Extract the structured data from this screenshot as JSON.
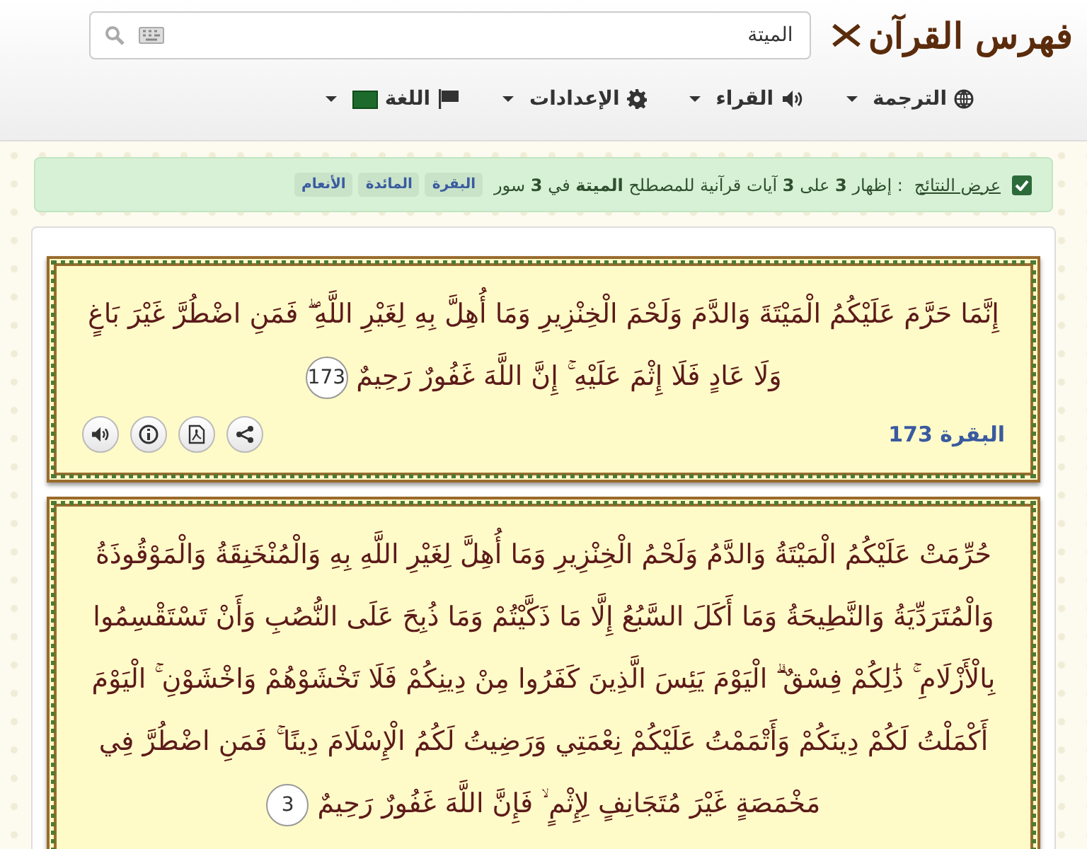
{
  "logo": {
    "title": "فهرس القرآن"
  },
  "search": {
    "value": "الميتة"
  },
  "menu": [
    {
      "label": "الترجمة",
      "kind": "globe"
    },
    {
      "label": "القراء",
      "kind": "speaker"
    },
    {
      "label": "الإعدادات",
      "kind": "gear"
    },
    {
      "label": "اللغة",
      "kind": "flag"
    }
  ],
  "summary": {
    "checked": true,
    "link": "عرض النتائج",
    "text": ": إظهار **3** على **3** آيات قرآنية للمصطلح **الميتة** في **3** سور",
    "tags": [
      "البقرة",
      "المائدة",
      "الأنعام"
    ]
  },
  "verses": [
    {
      "text": "إِنَّمَا حَرَّمَ عَلَيْكُمُ الْمَيْتَةَ وَالدَّمَ وَلَحْمَ الْخِنْزِيرِ وَمَا أُهِلَّ بِهِ لِغَيْرِ اللَّهِ ۖ فَمَنِ اضْطُرَّ غَيْرَ بَاغٍ وَلَا عَادٍ فَلَا إِثْمَ عَلَيْهِ ۚ إِنَّ اللَّهَ غَفُورٌ رَحِيمٌ",
      "number": "173",
      "reference": "البقرة 173"
    },
    {
      "text": "حُرِّمَتْ عَلَيْكُمُ الْمَيْتَةُ وَالدَّمُ وَلَحْمُ الْخِنْزِيرِ وَمَا أُهِلَّ لِغَيْرِ اللَّهِ بِهِ وَالْمُنْخَنِقَةُ وَالْمَوْقُوذَةُ وَالْمُتَرَدِّيَةُ وَالنَّطِيحَةُ وَمَا أَكَلَ السَّبُعُ إِلَّا مَا ذَكَّيْتُمْ وَمَا ذُبِحَ عَلَى النُّصُبِ وَأَنْ تَسْتَقْسِمُوا بِالْأَزْلَامِ ۚ ذَٰلِكُمْ فِسْقٌ ۗ الْيَوْمَ يَئِسَ الَّذِينَ كَفَرُوا مِنْ دِينِكُمْ فَلَا تَخْشَوْهُمْ وَاخْشَوْنِ ۚ الْيَوْمَ أَكْمَلْتُ لَكُمْ دِينَكُمْ وَأَتْمَمْتُ عَلَيْكُمْ نِعْمَتِي وَرَضِيتُ لَكُمُ الْإِسْلَامَ دِينًا ۚ فَمَنِ اضْطُرَّ فِي مَخْمَصَةٍ غَيْرَ مُتَجَانِفٍ لِإِثْمٍ ۙ فَإِنَّ اللَّهَ غَفُورٌ رَحِيمٌ",
      "number": "3"
    }
  ]
}
